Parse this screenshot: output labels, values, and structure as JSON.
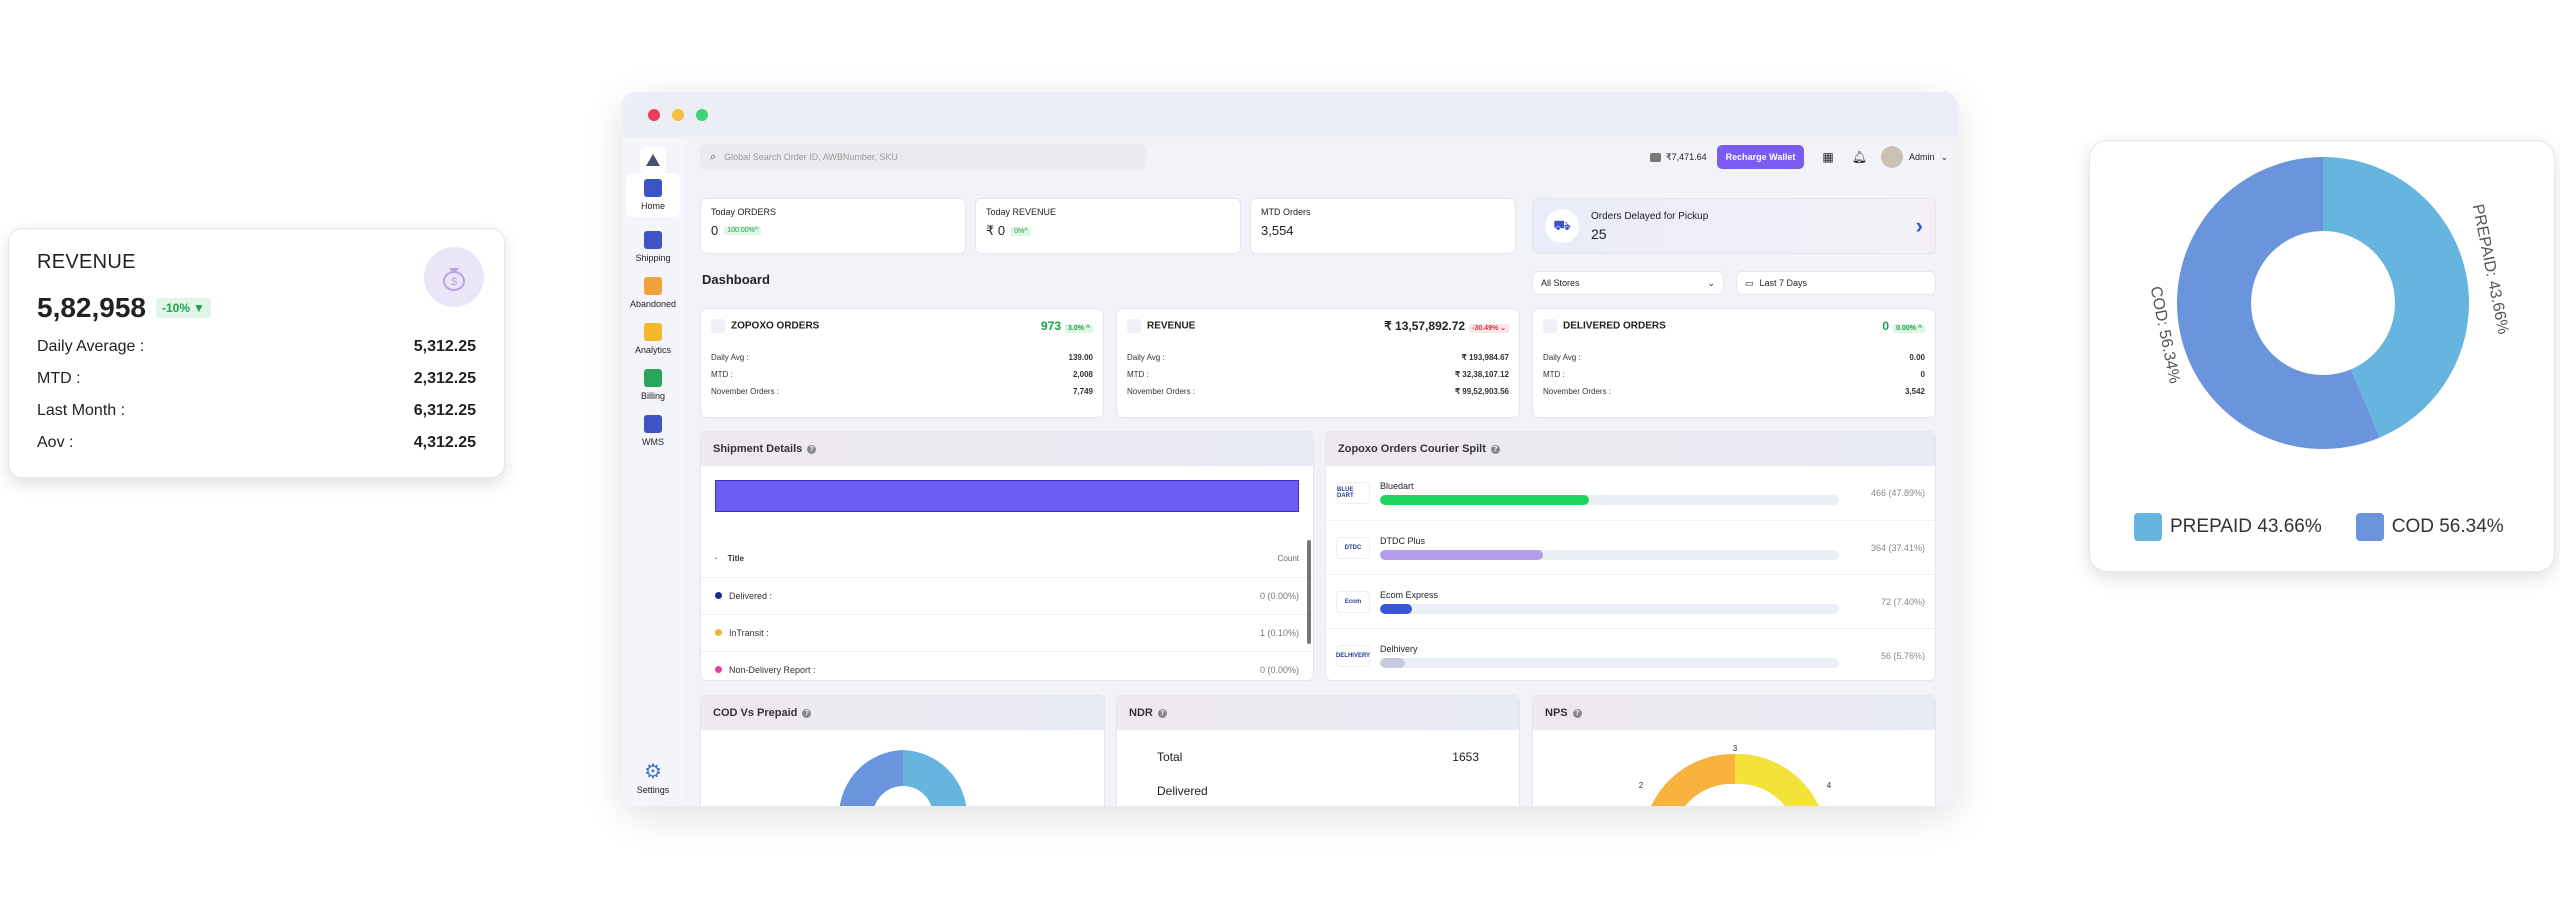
{
  "revenue_card": {
    "title": "REVENUE",
    "value": "5,82,958",
    "change": "-10%",
    "rows": [
      {
        "label": "Daily Average :",
        "value": "5,312.25"
      },
      {
        "label": "MTD :",
        "value": "2,312.25"
      },
      {
        "label": "Last Month :",
        "value": "6,312.25"
      },
      {
        "label": "Aov :",
        "value": "4,312.25"
      }
    ]
  },
  "window_colors": {
    "close": "#ec3b5d",
    "minimize": "#f6bf3d",
    "maximize": "#3fd374"
  },
  "sidebar": {
    "items": [
      {
        "label": "Home",
        "icon": "home-icon",
        "color": "#3d54c4"
      },
      {
        "label": "Shipping",
        "icon": "shipping-icon",
        "color": "#3d54c4"
      },
      {
        "label": "Abandoned",
        "icon": "abandoned-icon",
        "color": "#f0a23b"
      },
      {
        "label": "Analytics",
        "icon": "analytics-icon",
        "color": "#f4b82a"
      },
      {
        "label": "Billing",
        "icon": "billing-icon",
        "color": "#2aa55a"
      },
      {
        "label": "WMS",
        "icon": "wms-icon",
        "color": "#3d54c4"
      }
    ],
    "settings_label": "Settings"
  },
  "header": {
    "search_placeholder": "Global Search Order ID, AWBNumber, SKU",
    "wallet_amount": "₹7,471.64",
    "recharge_label": "Recharge Wallet",
    "user_name": "Admin"
  },
  "kpis": [
    {
      "label": "Today ORDERS",
      "value": "0",
      "badge": "100.00%^"
    },
    {
      "label": "Today REVENUE",
      "value": "₹ 0",
      "badge": "0%^"
    },
    {
      "label": "MTD Orders",
      "value": "3,554",
      "badge": ""
    }
  ],
  "delayed": {
    "label": "Orders Delayed for Pickup",
    "value": "25"
  },
  "dashboard": {
    "title": "Dashboard",
    "store_select": "All Stores",
    "date_select": "Last 7 Days"
  },
  "metrics": [
    {
      "title": "ZOPOXO ORDERS",
      "value": "973",
      "badge": "3.0% ^",
      "badge_type": "up",
      "rows": [
        [
          "Daily Avg :",
          "139.00"
        ],
        [
          "MTD :",
          "2,008"
        ],
        [
          "November Orders :",
          "7,749"
        ]
      ]
    },
    {
      "title": "REVENUE",
      "value": "₹ 13,57,892.72",
      "badge": "-30.49% ⌄",
      "badge_type": "down",
      "rows": [
        [
          "Daily Avg :",
          "₹ 193,984.67"
        ],
        [
          "MTD :",
          "₹ 32,38,107.12"
        ],
        [
          "November Orders :",
          "₹ 99,52,903.56"
        ]
      ]
    },
    {
      "title": "DELIVERED ORDERS",
      "value": "0",
      "badge": "0.00% ^",
      "badge_type": "up",
      "rows": [
        [
          "Daily Avg :",
          "0.00"
        ],
        [
          "MTD :",
          "0"
        ],
        [
          "November Orders :",
          "3,542"
        ]
      ]
    }
  ],
  "shipment": {
    "title": "Shipment Details",
    "col_title": "Title",
    "col_count": "Count",
    "rows": [
      {
        "label": "Delivered :",
        "count": "0 (0.00%)",
        "color": "#1c2b8f"
      },
      {
        "label": "InTransit :",
        "count": "1 (0.10%)",
        "color": "#f0b43a"
      },
      {
        "label": "Non-Delivery Report :",
        "count": "0 (0.00%)",
        "color": "#e83e9e"
      }
    ]
  },
  "courier": {
    "title": "Zopoxo Orders Courier Spilt",
    "rows": [
      {
        "name": "Bluedart",
        "value": "466 (47.89%)",
        "fraction": 0.4789,
        "color": "#1ed65f",
        "logo": "BLUE DART"
      },
      {
        "name": "DTDC Plus",
        "value": "364 (37.41%)",
        "fraction": 0.3741,
        "color": "#b49cec",
        "logo": "DTDC"
      },
      {
        "name": "Ecom Express",
        "value": "72 (7.40%)",
        "fraction": 0.074,
        "color": "#3b55d6",
        "logo": "Ecom"
      },
      {
        "name": "Delhivery",
        "value": "56 (5.76%)",
        "fraction": 0.0576,
        "color": "#c7cbe0",
        "logo": "DELHIVERY"
      }
    ]
  },
  "bottom_panels": {
    "cod_title": "COD Vs Prepaid",
    "ndr_title": "NDR",
    "ndr_total_label": "Total",
    "ndr_total_value": "1653",
    "ndr_delivered_label": "Delivered",
    "nps_title": "NPS",
    "nps_ticks": [
      "3",
      "2",
      "4"
    ]
  },
  "donut_card": {
    "chart_data": {
      "type": "pie",
      "categories": [
        "PREPAID",
        "COD"
      ],
      "values": [
        43.66,
        56.34
      ],
      "labels": [
        "PREPAID: 43.66%",
        "COD: 56.34%"
      ],
      "legend": [
        "PREPAID 43.66%",
        "COD 56.34%"
      ],
      "colors": [
        "#66b5de",
        "#6a95dc"
      ],
      "legend_position": "bottom"
    }
  }
}
